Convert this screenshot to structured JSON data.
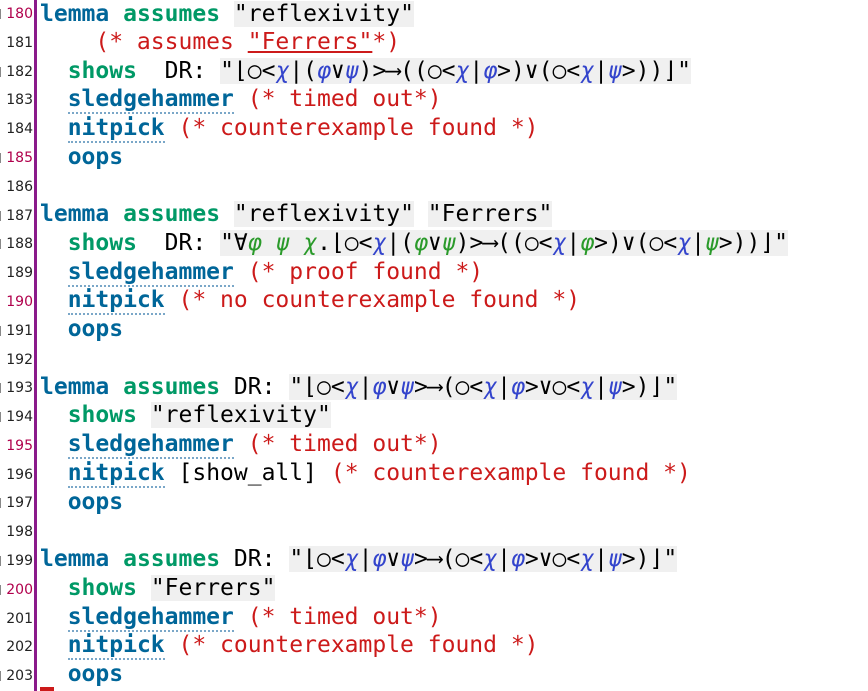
{
  "lines": [
    {
      "n": "180",
      "mod": true,
      "fold": true
    },
    {
      "n": "181"
    },
    {
      "n": "182",
      "fold": true
    },
    {
      "n": "183"
    },
    {
      "n": "184"
    },
    {
      "n": "185",
      "mod": true,
      "fold": true
    },
    {
      "n": "186"
    },
    {
      "n": "187",
      "fold": true
    },
    {
      "n": "188",
      "fold": true
    },
    {
      "n": "189"
    },
    {
      "n": "190",
      "mod": true
    },
    {
      "n": "191",
      "fold": true
    },
    {
      "n": "192"
    },
    {
      "n": "193",
      "fold": true
    },
    {
      "n": "194",
      "fold": true
    },
    {
      "n": "195",
      "mod": true
    },
    {
      "n": "196"
    },
    {
      "n": "197",
      "fold": true
    },
    {
      "n": "198"
    },
    {
      "n": "199",
      "fold": true
    },
    {
      "n": "200",
      "mod": true,
      "fold": true
    },
    {
      "n": "201"
    },
    {
      "n": "202"
    },
    {
      "n": "203",
      "fold": true
    }
  ],
  "kw": {
    "lemma": "lemma",
    "assumes": "assumes",
    "shows": "shows",
    "sledgehammer": "sledgehammer",
    "nitpick": "nitpick",
    "oops": "oops",
    "dr": "DR:"
  },
  "text": {
    "refl": "\"reflexivity\"",
    "ferrers": "\"Ferrers\"",
    "cmt_assumes_pre": "(* assumes ",
    "cmt_assumes_mid": "\"Ferrers\"",
    "cmt_assumes_post": "*)",
    "timed_out": "(* timed out*)",
    "cex_found": "(* counterexample found *)",
    "proof_found": "(* proof found *)",
    "no_cex": "(* no counterexample found *)",
    "show_all": "[show_all]",
    "forall_prefix": "\"∀",
    "dot": ".",
    "open": "⌊○<",
    "close": "⌋\""
  },
  "colors": {
    "keyword_blue": "#006699",
    "keyword_green": "#009966",
    "comment_red": "#cc1a1a",
    "gutter_bar": "#8a1a8a",
    "var_blue": "#3344cc",
    "var_green": "#2a9a2a"
  }
}
